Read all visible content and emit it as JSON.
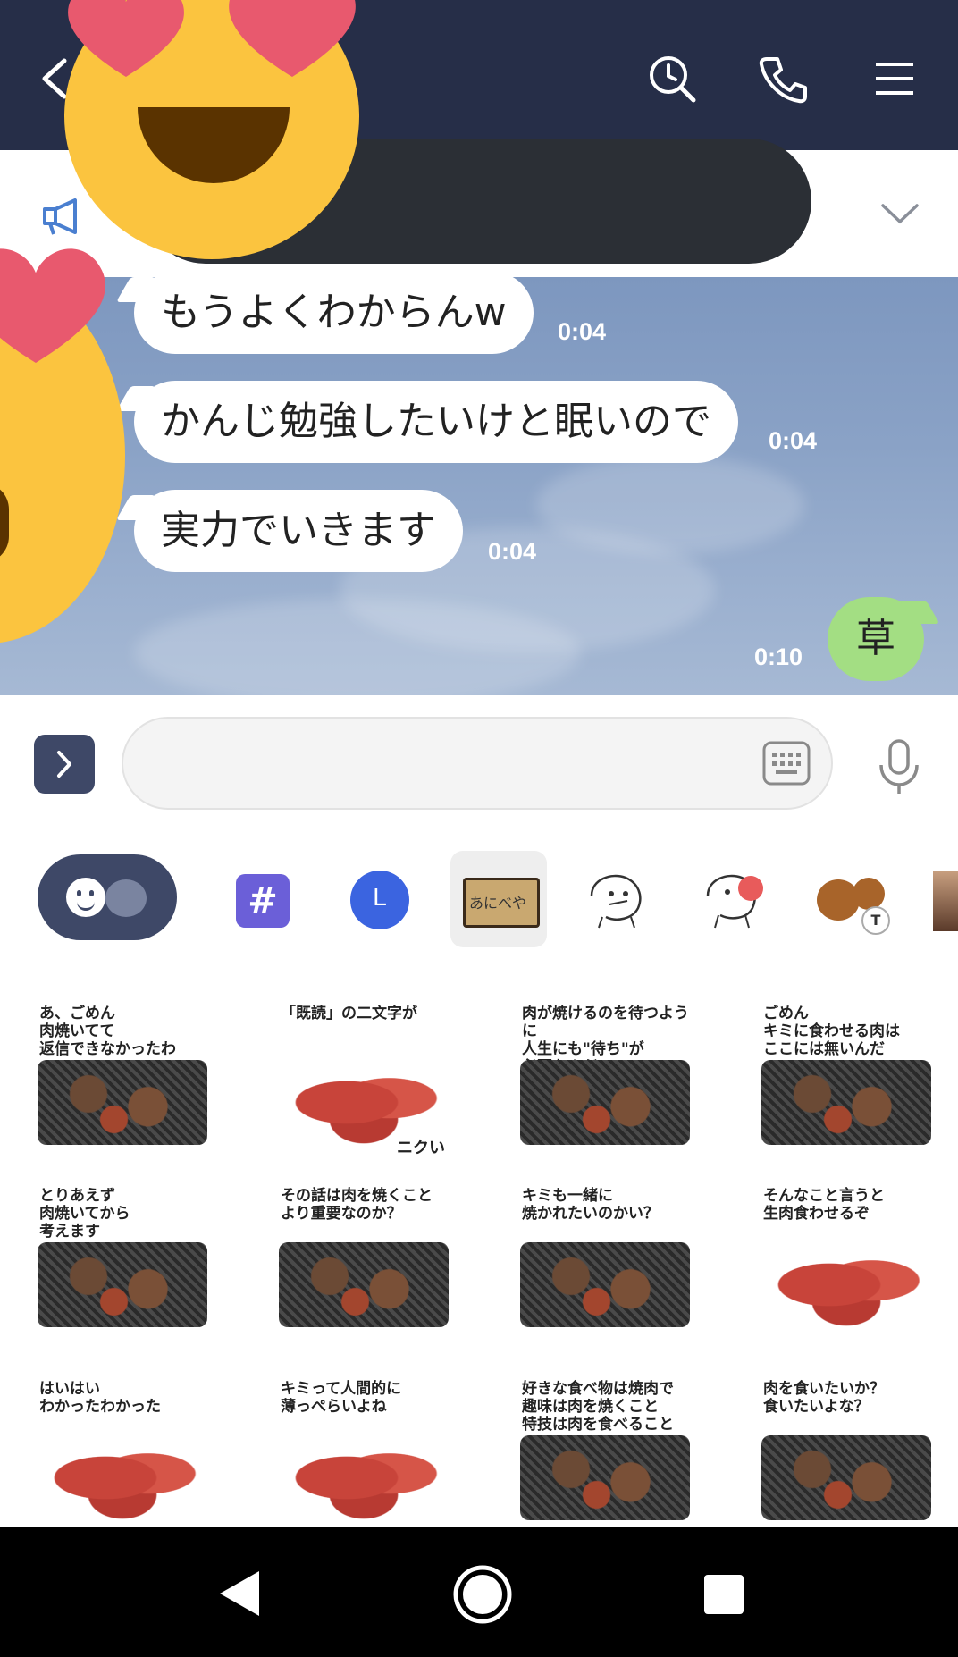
{
  "header": {
    "back_icon": "chevron-left-icon",
    "search_icon": "search-clock-icon",
    "call_icon": "phone-icon",
    "menu_icon": "hamburger-menu-icon"
  },
  "announcement": {
    "icon": "megaphone-icon",
    "text": "",
    "expand_icon": "chevron-down-icon"
  },
  "messages": [
    {
      "text": "もうよくわからんw",
      "time": "0:04",
      "side": "in"
    },
    {
      "text": "かんじ勉強したいけと眠いので",
      "time": "0:04",
      "side": "in"
    },
    {
      "text": "実力でいきます",
      "time": "0:04",
      "side": "in"
    },
    {
      "text": "草",
      "time": "0:10",
      "side": "out"
    }
  ],
  "input": {
    "placeholder": "",
    "expand_icon": "chevron-right-icon",
    "keyboard_icon": "keyboard-icon",
    "mic_icon": "microphone-icon"
  },
  "sticker_tabs": [
    {
      "name": "emoji",
      "icon": "smiley-bear-icon"
    },
    {
      "name": "hashtag",
      "label": "#"
    },
    {
      "name": "line-store",
      "label": "L"
    },
    {
      "name": "anibeya",
      "label": "あにべや"
    },
    {
      "name": "face-sticker-1",
      "icon": "doodle-face-icon"
    },
    {
      "name": "face-sticker-2",
      "icon": "doodle-face-apple-icon"
    },
    {
      "name": "bear-sticker",
      "icon": "bear-icon",
      "badge": "T"
    },
    {
      "name": "more-sticker",
      "icon": "sticker-icon"
    }
  ],
  "stickers": [
    {
      "caption": "あ、ごめん\n肉焼いてて\n返信できなかったわ",
      "style": "grill"
    },
    {
      "caption": "「既読」の二文字が",
      "sub": "ニクい",
      "style": "raw"
    },
    {
      "caption": "肉が焼けるのを待つように\n人生にも\"待ち\"が\n必要なんだ",
      "style": "grill"
    },
    {
      "caption": "ごめん\nキミに食わせる肉は\nここには無いんだ",
      "style": "grill"
    },
    {
      "caption": "とりあえず\n肉焼いてから\n考えます",
      "style": "grill"
    },
    {
      "caption": "その話は肉を焼くこと\nより重要なのか？",
      "style": "grill"
    },
    {
      "caption": "キミも一緒に\n焼かれたいのかい？",
      "style": "grill"
    },
    {
      "caption": "そんなこと言うと\n生肉食わせるぞ",
      "style": "raw"
    },
    {
      "caption": "はいはい\nわかったわかった",
      "style": "raw"
    },
    {
      "caption": "キミって人間的に\n薄っぺらいよね",
      "style": "raw"
    },
    {
      "caption": "好きな食べ物は焼肉で\n趣味は肉を焼くこと\n特技は肉を食べること",
      "style": "grill"
    },
    {
      "caption": "肉を食いたいか？\n食いたいよな？",
      "style": "grill"
    }
  ],
  "navbar": {
    "back_icon": "triangle-back-icon",
    "home_icon": "circle-home-icon",
    "recents_icon": "square-recents-icon"
  }
}
